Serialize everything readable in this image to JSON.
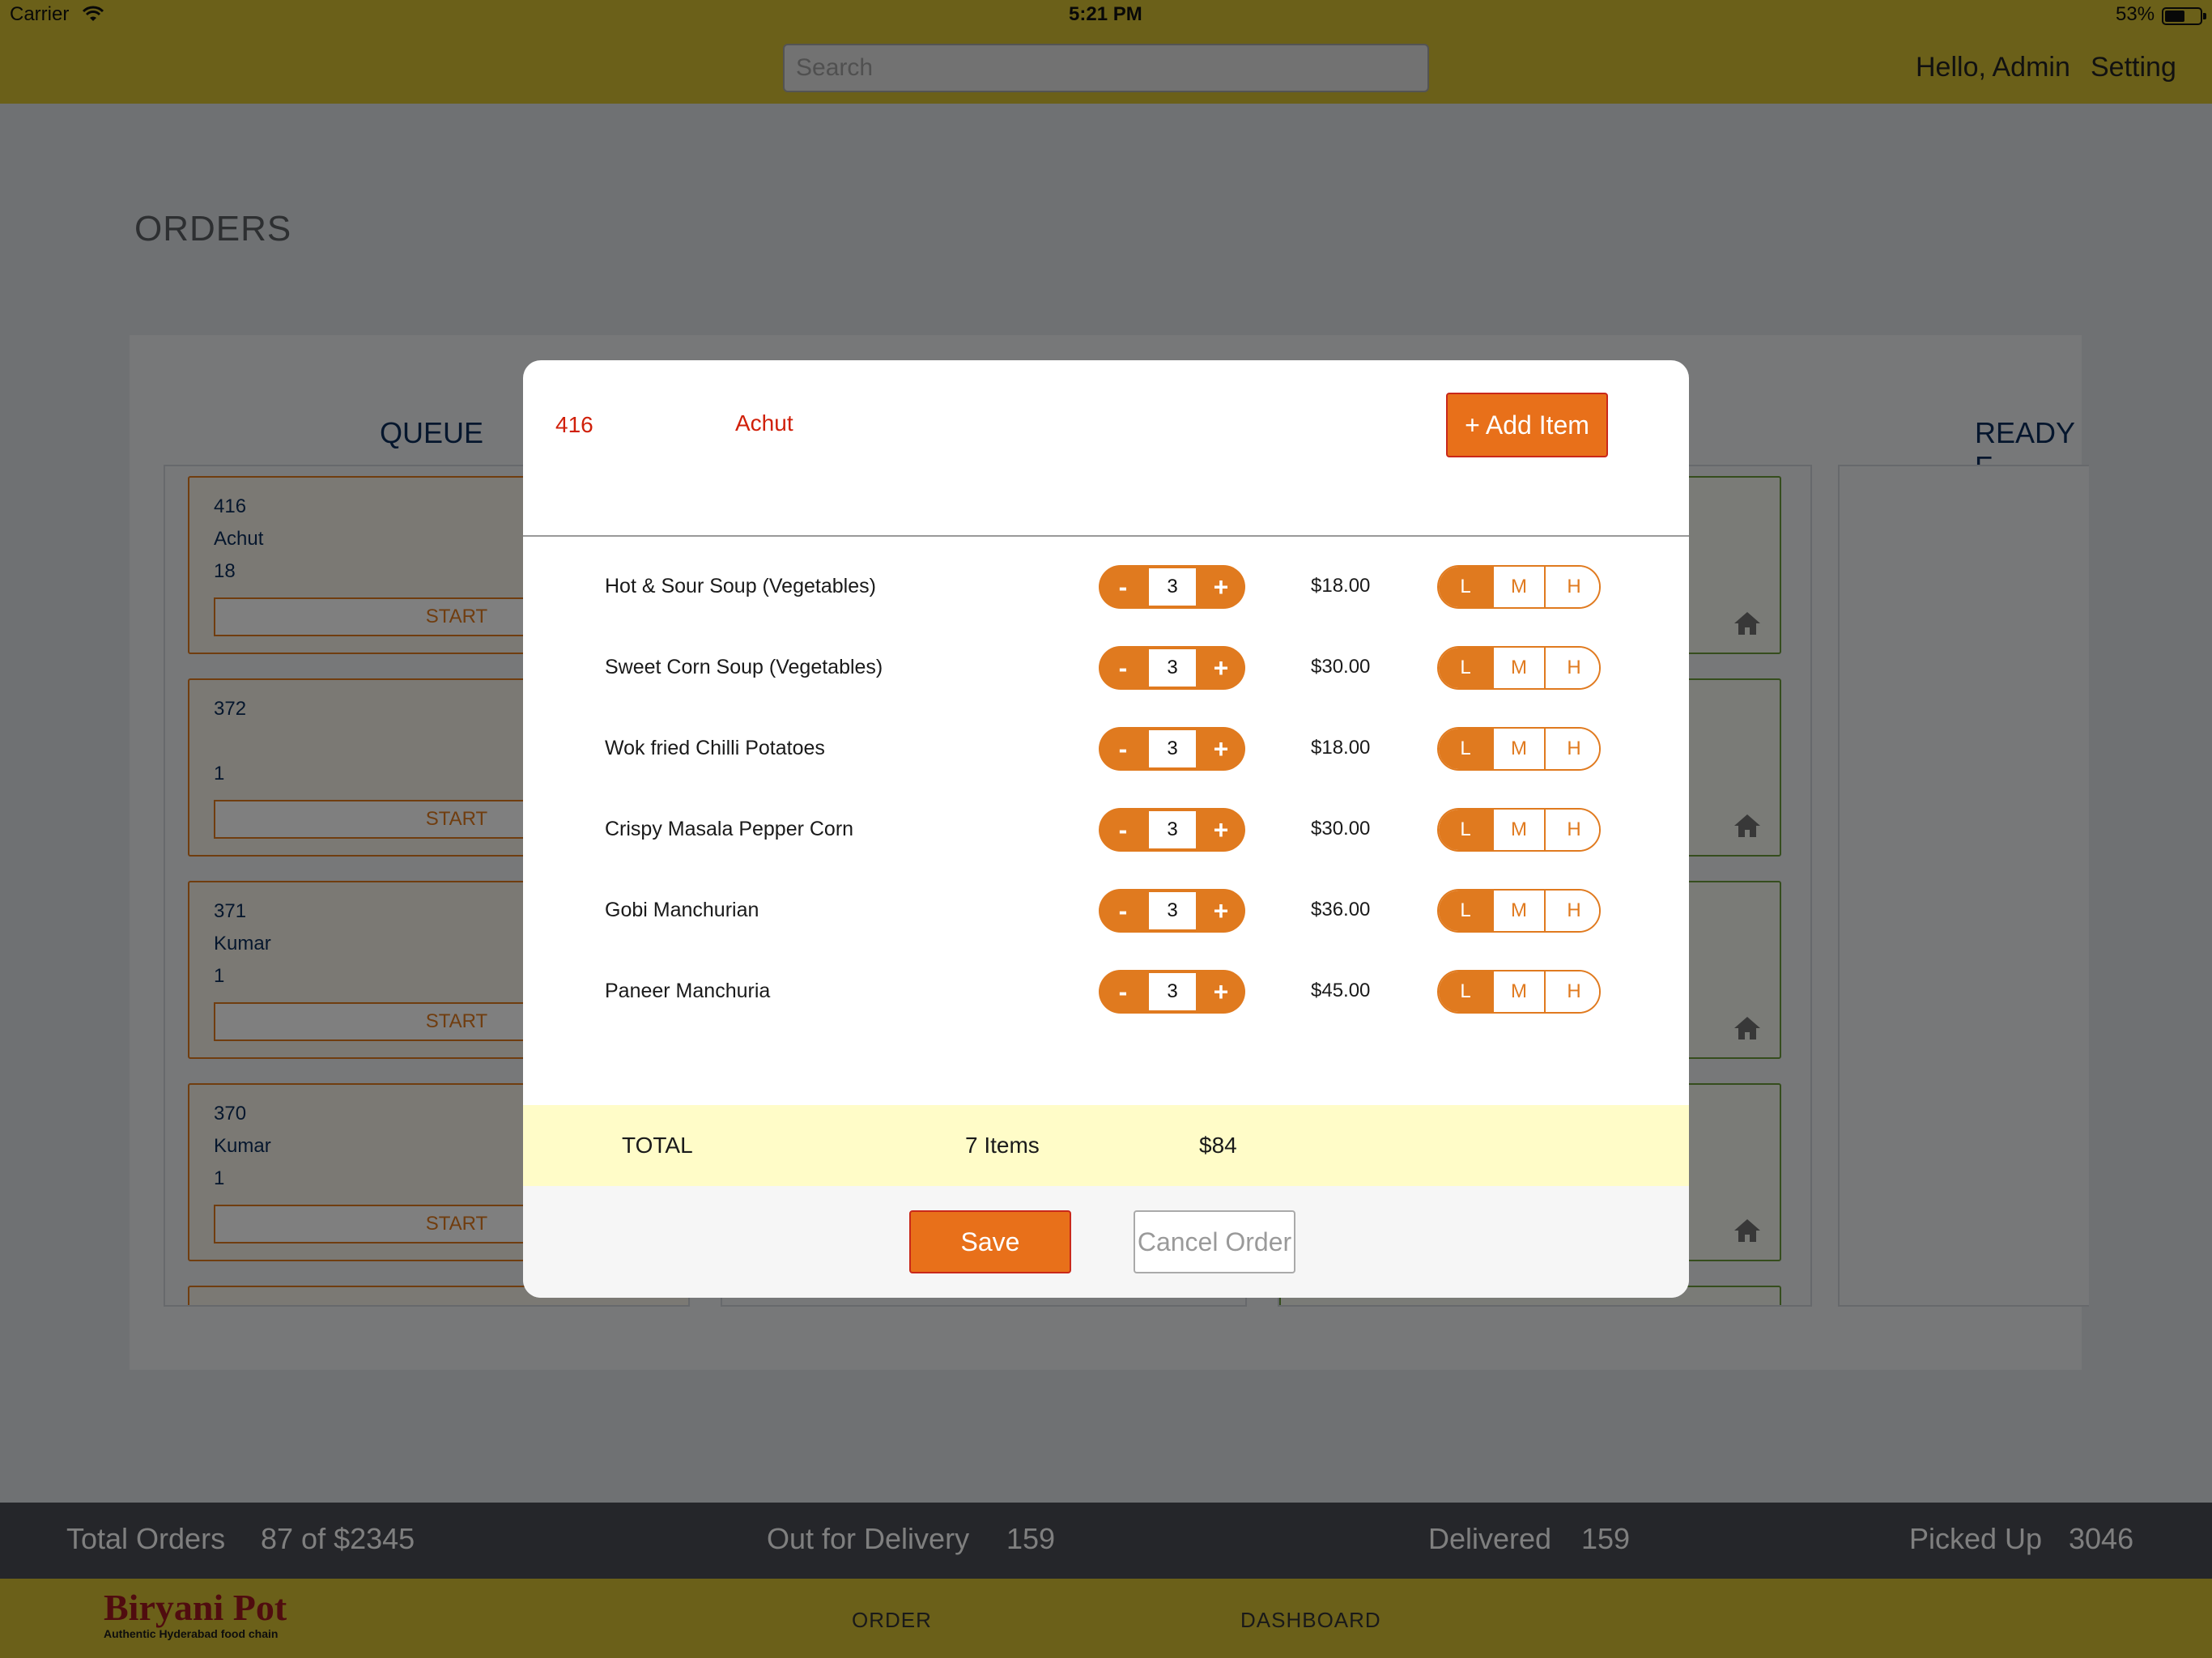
{
  "status_bar": {
    "carrier": "Carrier",
    "time": "5:21 PM",
    "battery": "53%"
  },
  "header": {
    "search_placeholder": "Search",
    "greeting": "Hello, Admin",
    "setting": "Setting"
  },
  "page_title": "ORDERS",
  "columns": {
    "queue_title": "QUEUE",
    "ready_title": "READY F"
  },
  "queue_cards": [
    {
      "id": "416",
      "name": "Achut",
      "count": "18",
      "action": "START"
    },
    {
      "id": "372",
      "name": "",
      "count": "1",
      "action": "START"
    },
    {
      "id": "371",
      "name": "Kumar",
      "count": "1",
      "action": "START"
    },
    {
      "id": "370",
      "name": "Kumar",
      "count": "1",
      "action": "START"
    }
  ],
  "modal": {
    "order_no": "416",
    "customer": "Achut",
    "add_item_label": "+ Add Item",
    "items": [
      {
        "name": "Hot & Sour Soup (Vegetables)",
        "qty": "3",
        "price": "$18.00",
        "level": "L"
      },
      {
        "name": "Sweet Corn Soup (Vegetables)",
        "qty": "3",
        "price": "$30.00",
        "level": "L"
      },
      {
        "name": "Wok fried Chilli Potatoes",
        "qty": "3",
        "price": "$18.00",
        "level": "L"
      },
      {
        "name": "Crispy Masala Pepper Corn",
        "qty": "3",
        "price": "$30.00",
        "level": "L"
      },
      {
        "name": "Gobi Manchurian",
        "qty": "3",
        "price": "$36.00",
        "level": "L"
      },
      {
        "name": "Paneer Manchuria",
        "qty": "3",
        "price": "$45.00",
        "level": "L"
      }
    ],
    "stepper": {
      "minus": "-",
      "plus": "+"
    },
    "levels": [
      "L",
      "M",
      "H"
    ],
    "total": {
      "label": "TOTAL",
      "count": "7 Items",
      "amount": "$84"
    },
    "save_label": "Save",
    "cancel_label": "Cancel Order"
  },
  "summary": {
    "total_orders_label": "Total Orders",
    "total_orders_value": "87 of $2345",
    "out_for_delivery_label": "Out for Delivery",
    "out_for_delivery_value": "159",
    "delivered_label": "Delivered",
    "delivered_value": "159",
    "picked_up_label": "Picked Up",
    "picked_up_value": "3046"
  },
  "bottom_nav": {
    "logo_text": "Biryani Pot",
    "logo_tagline": "Authentic Hyderabad food chain",
    "order": "ORDER",
    "dashboard": "DASHBOARD"
  },
  "colors": {
    "brand_bar": "#d6c033",
    "accent": "#e07a1f",
    "alert_text": "#d0200a",
    "total_row": "#fffcc8",
    "summary_bar": "#4a4d55"
  },
  "icons": [
    "wifi-icon",
    "battery-icon",
    "home-icon"
  ]
}
